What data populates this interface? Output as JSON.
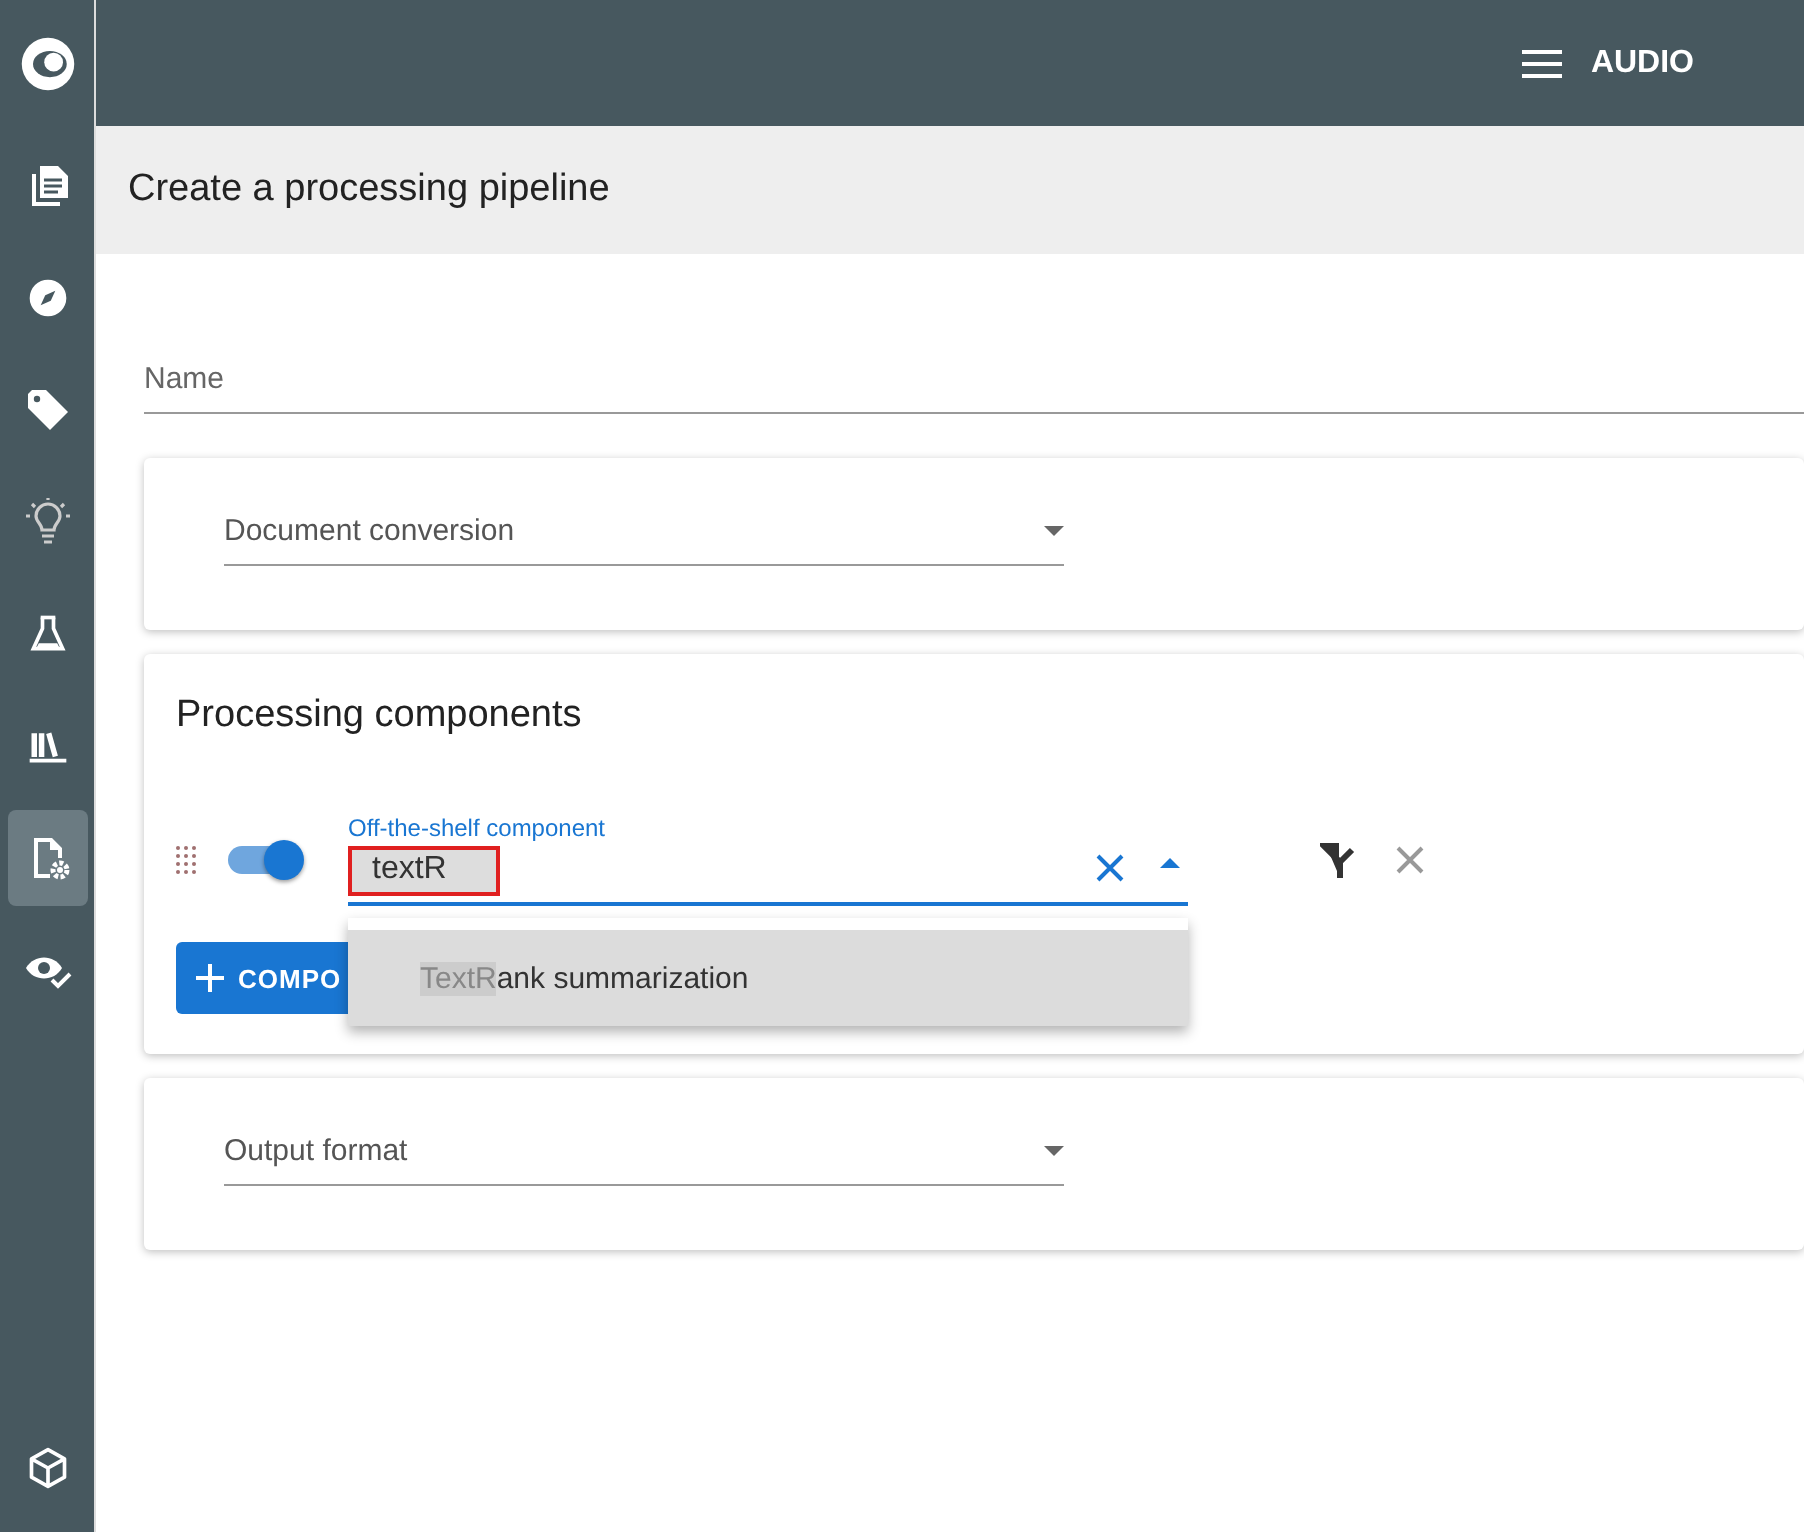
{
  "topbar": {
    "title": "AUDIO"
  },
  "sidebar": {
    "items": [
      {
        "selected": false
      },
      {
        "selected": false
      },
      {
        "selected": false
      },
      {
        "selected": false
      },
      {
        "selected": false
      },
      {
        "selected": false
      },
      {
        "selected": true
      },
      {
        "selected": false
      }
    ],
    "bottom_items": [
      {
        "selected": false
      }
    ]
  },
  "page_title": "Create a processing pipeline",
  "name_field": {
    "placeholder": "Name"
  },
  "conversion": {
    "placeholder": "Document conversion"
  },
  "processing": {
    "title": "Processing components",
    "component": {
      "enabled": true,
      "label": "Off-the-shelf component",
      "value": "textR"
    },
    "suggestions": [
      {
        "match": "TextR",
        "rest": "ank summarization"
      }
    ],
    "add_button": "COMPO"
  },
  "output": {
    "placeholder": "Output format"
  }
}
